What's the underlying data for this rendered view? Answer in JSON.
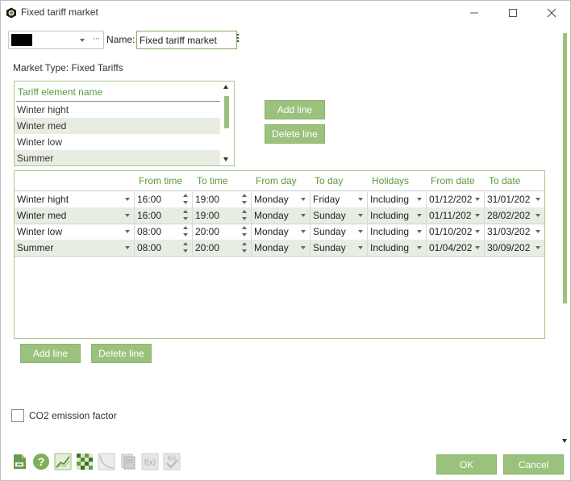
{
  "window": {
    "title": "Fixed tariff market",
    "minimize_icon": "minimize-icon",
    "maximize_icon": "maximize-icon",
    "close_icon": "close-icon"
  },
  "header": {
    "color_value": "#000000",
    "name_label": "Name:",
    "name_value": "Fixed tariff market"
  },
  "market_type": "Market Type: Fixed Tariffs",
  "tariff_list": {
    "header": "Tariff element name",
    "items": [
      "Winter hight",
      "Winter med",
      "Winter low",
      "Summer"
    ]
  },
  "tariff_buttons": {
    "add": "Add line",
    "delete": "Delete line"
  },
  "grid": {
    "columns": [
      "",
      "From time",
      "To time",
      "From day",
      "To day",
      "Holidays",
      "From date",
      "To date"
    ],
    "rows": [
      [
        "Winter hight",
        "16:00",
        "19:00",
        "Monday",
        "Friday",
        "Including",
        "01/12/202",
        "31/01/202"
      ],
      [
        "Winter med",
        "16:00",
        "19:00",
        "Monday",
        "Sunday",
        "Including",
        "01/11/202",
        "28/02/202"
      ],
      [
        "Winter low",
        "08:00",
        "20:00",
        "Monday",
        "Sunday",
        "Including",
        "01/10/202",
        "31/03/202"
      ],
      [
        "Summer",
        "08:00",
        "20:00",
        "Monday",
        "Sunday",
        "Including",
        "01/04/202",
        "30/09/202"
      ]
    ]
  },
  "grid_buttons": {
    "add": "Add line",
    "delete": "Delete line"
  },
  "co2": {
    "label": "CO2 emission factor",
    "checked": false
  },
  "footer": {
    "ok": "OK",
    "cancel": "Cancel",
    "fx_label": "f(x)",
    "tools": [
      "export-icon",
      "help-icon",
      "chart-icon",
      "grid-pattern-icon",
      "curve-icon",
      "document-icon",
      "function-icon",
      "function-check-icon"
    ]
  },
  "colors": {
    "accent": "#9bc27d",
    "header_text": "#5a9a3a",
    "alt_row": "#e8ede4"
  }
}
